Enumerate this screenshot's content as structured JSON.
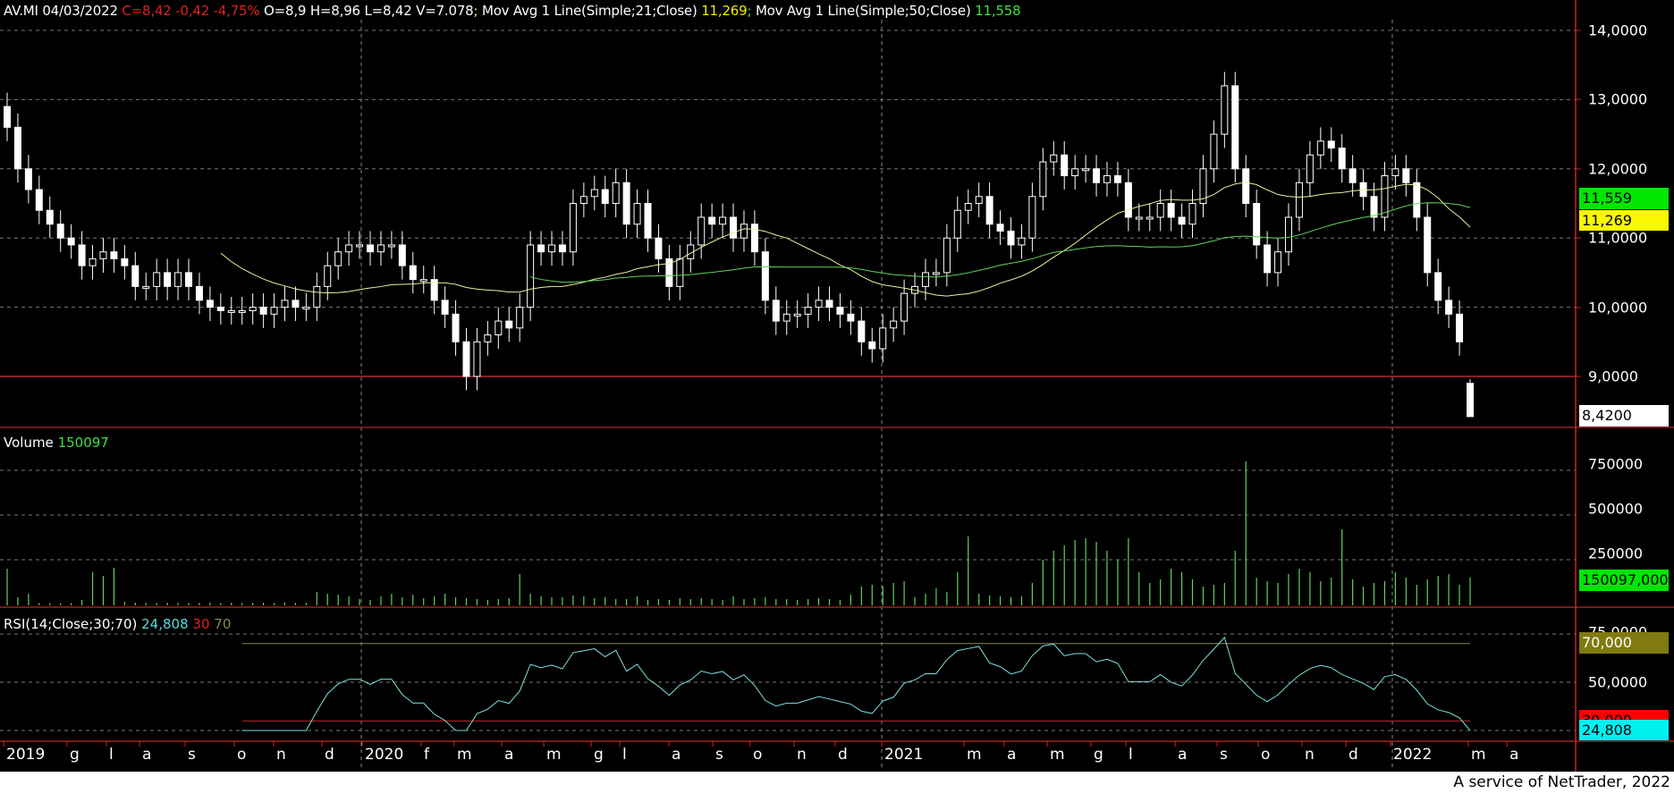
{
  "header": {
    "symbol": "AV.MI",
    "date": "04/03/2022",
    "change": "C=8,42 -0,42 -4,75%",
    "ohlcv": "O=8,9 H=8,96 L=8,42 V=7.078",
    "sep": ";",
    "ma21_label": "Mov Avg 1 Line(Simple;21;Close)",
    "ma21_value": "11,269",
    "ma50_label": "Mov Avg 1 Line(Simple;50;Close)",
    "ma50_value": "11,558"
  },
  "volume_panel": {
    "label": "Volume",
    "value": "150097",
    "box": "150097,000"
  },
  "rsi_panel": {
    "label": "RSI(14;Close;30;70)",
    "value": "24,808",
    "low": "30",
    "high": "70",
    "box_value": "24,808",
    "box_low": "30,000",
    "box_high": "70,000"
  },
  "price_axis": {
    "ticks": [
      "14,0000",
      "13,0000",
      "12,0000",
      "11,0000",
      "10,0000",
      "9,0000"
    ],
    "last_box": "8,4200",
    "ma50_box": "11,559",
    "ma21_box": "11,269"
  },
  "volume_axis": {
    "ticks": [
      "750000",
      "500000",
      "250000"
    ]
  },
  "rsi_axis": {
    "ticks": [
      "75,0000",
      "50,0000"
    ]
  },
  "x_axis": {
    "labels": [
      "2019",
      "g",
      "l",
      "a",
      "s",
      "o",
      "n",
      "d",
      "2020",
      "f",
      "m",
      "a",
      "m",
      "g",
      "l",
      "a",
      "s",
      "o",
      "n",
      "d",
      "2021",
      "m",
      "a",
      "m",
      "g",
      "l",
      "a",
      "s",
      "o",
      "n",
      "d",
      "2022",
      "m",
      "a"
    ]
  },
  "footer": "A service of NetTrader, 2022",
  "colors": {
    "candle": "#ffffff",
    "ma21": "#e8f0a0",
    "ma50": "#5fd35f",
    "volume": "#5fd35f",
    "rsi": "#7fe0e0",
    "support": "#c0282a",
    "axis": "#c0282a"
  },
  "chart_data": {
    "type": "candlestick",
    "title": "AV.MI weekly",
    "interval": "weekly",
    "price_ylim": [
      8.3,
      14.1
    ],
    "last_candle": {
      "open": 8.9,
      "high": 8.96,
      "low": 8.42,
      "close": 8.42
    },
    "support_line": 9.0,
    "close": [
      12.6,
      12.0,
      11.7,
      11.4,
      11.2,
      11.0,
      10.9,
      10.6,
      10.7,
      10.8,
      10.7,
      10.6,
      10.3,
      10.3,
      10.5,
      10.3,
      10.5,
      10.3,
      10.1,
      10.0,
      9.95,
      9.95,
      9.95,
      10.0,
      9.9,
      10.0,
      10.1,
      10.0,
      10.0,
      10.3,
      10.6,
      10.8,
      10.9,
      10.9,
      10.8,
      10.9,
      10.9,
      10.6,
      10.4,
      10.4,
      10.1,
      9.9,
      9.5,
      9.0,
      9.5,
      9.6,
      9.8,
      9.7,
      10.0,
      10.9,
      10.8,
      10.9,
      10.8,
      11.5,
      11.6,
      11.7,
      11.5,
      11.8,
      11.2,
      11.5,
      11.0,
      10.7,
      10.3,
      10.7,
      10.9,
      11.3,
      11.2,
      11.3,
      11.0,
      11.2,
      10.8,
      10.1,
      9.8,
      9.9,
      9.9,
      10.0,
      10.1,
      10.0,
      9.9,
      9.8,
      9.5,
      9.4,
      9.7,
      9.8,
      10.2,
      10.3,
      10.5,
      10.5,
      11.0,
      11.4,
      11.5,
      11.6,
      11.2,
      11.1,
      10.9,
      11.0,
      11.6,
      12.1,
      12.2,
      11.9,
      12.0,
      12.0,
      11.8,
      11.9,
      11.8,
      11.3,
      11.3,
      11.3,
      11.5,
      11.3,
      11.2,
      11.5,
      12.0,
      12.5,
      13.2,
      12.0,
      11.5,
      10.9,
      10.5,
      10.8,
      11.3,
      11.8,
      12.2,
      12.4,
      12.3,
      12.0,
      11.8,
      11.6,
      11.3,
      11.9,
      12.0,
      11.8,
      11.3,
      10.5,
      10.1,
      9.9,
      9.5,
      8.42
    ],
    "volume": [
      200000,
      40000,
      60000,
      8000,
      6000,
      6000,
      8000,
      25000,
      180000,
      160000,
      205000,
      15000,
      10000,
      8000,
      8000,
      10000,
      8000,
      8000,
      8000,
      10000,
      8000,
      10000,
      8000,
      8000,
      10000,
      8000,
      12000,
      8000,
      10000,
      70000,
      60000,
      55000,
      45000,
      30000,
      25000,
      45000,
      60000,
      40000,
      55000,
      35000,
      45000,
      60000,
      40000,
      35000,
      30000,
      25000,
      30000,
      35000,
      170000,
      60000,
      45000,
      40000,
      40000,
      50000,
      45000,
      35000,
      40000,
      30000,
      30000,
      45000,
      25000,
      30000,
      25000,
      35000,
      30000,
      35000,
      30000,
      25000,
      45000,
      30000,
      35000,
      40000,
      30000,
      30000,
      25000,
      30000,
      35000,
      30000,
      25000,
      55000,
      100000,
      110000,
      100000,
      120000,
      130000,
      40000,
      60000,
      90000,
      70000,
      180000,
      380000,
      60000,
      50000,
      45000,
      40000,
      45000,
      120000,
      250000,
      300000,
      330000,
      360000,
      370000,
      350000,
      300000,
      250000,
      370000,
      180000,
      120000,
      140000,
      200000,
      180000,
      140000,
      100000,
      110000,
      120000,
      300000,
      800000,
      150000,
      130000,
      120000,
      170000,
      200000,
      180000,
      130000,
      150000,
      420000,
      140000,
      100000,
      120000,
      130000,
      180000,
      150000,
      110000,
      140000,
      160000,
      170000,
      110000,
      150097
    ],
    "volume_ylim": [
      0,
      850000
    ],
    "rsi_ylim": [
      25,
      77
    ],
    "rsi_levels": [
      30,
      70
    ]
  }
}
